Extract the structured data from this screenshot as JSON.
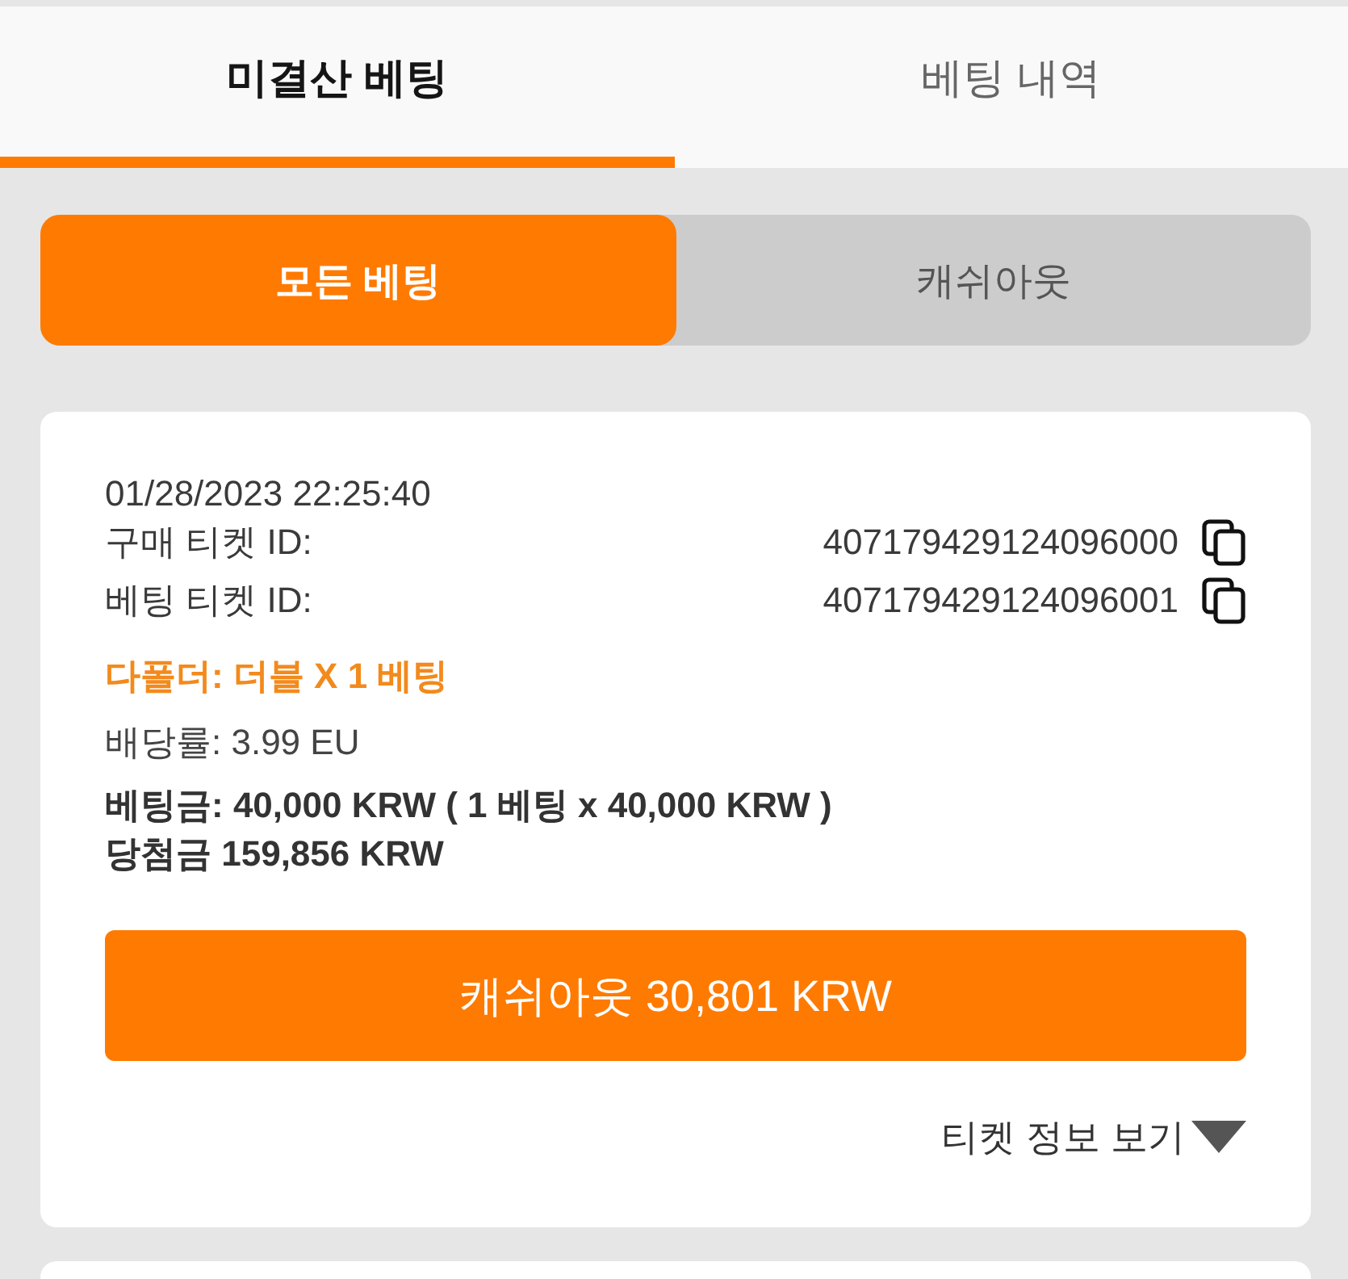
{
  "tabs": [
    {
      "label": "미결산 베팅",
      "selected": true
    },
    {
      "label": "베팅 내역",
      "selected": false
    }
  ],
  "filters": [
    {
      "label": "모든 베팅",
      "selected": true
    },
    {
      "label": "캐쉬아웃",
      "selected": false
    }
  ],
  "tickets": [
    {
      "datetime": "01/28/2023 22:25:40",
      "ids": [
        {
          "label": "구매 티켓 ID:",
          "value": "407179429124096000"
        },
        {
          "label": "베팅 티켓 ID:",
          "value": "407179429124096001"
        }
      ],
      "bet_type": "다폴더: 더블 X 1 베팅",
      "odds": "배당률: 3.99 EU",
      "stake": "베팅금: 40,000 KRW ( 1 베팅 x 40,000 KRW )",
      "winnings": "당첨금 159,856 KRW",
      "cashout_button": "캐쉬아웃 30,801 KRW",
      "details_link": "티켓 정보 보기",
      "expanded": false
    }
  ]
}
